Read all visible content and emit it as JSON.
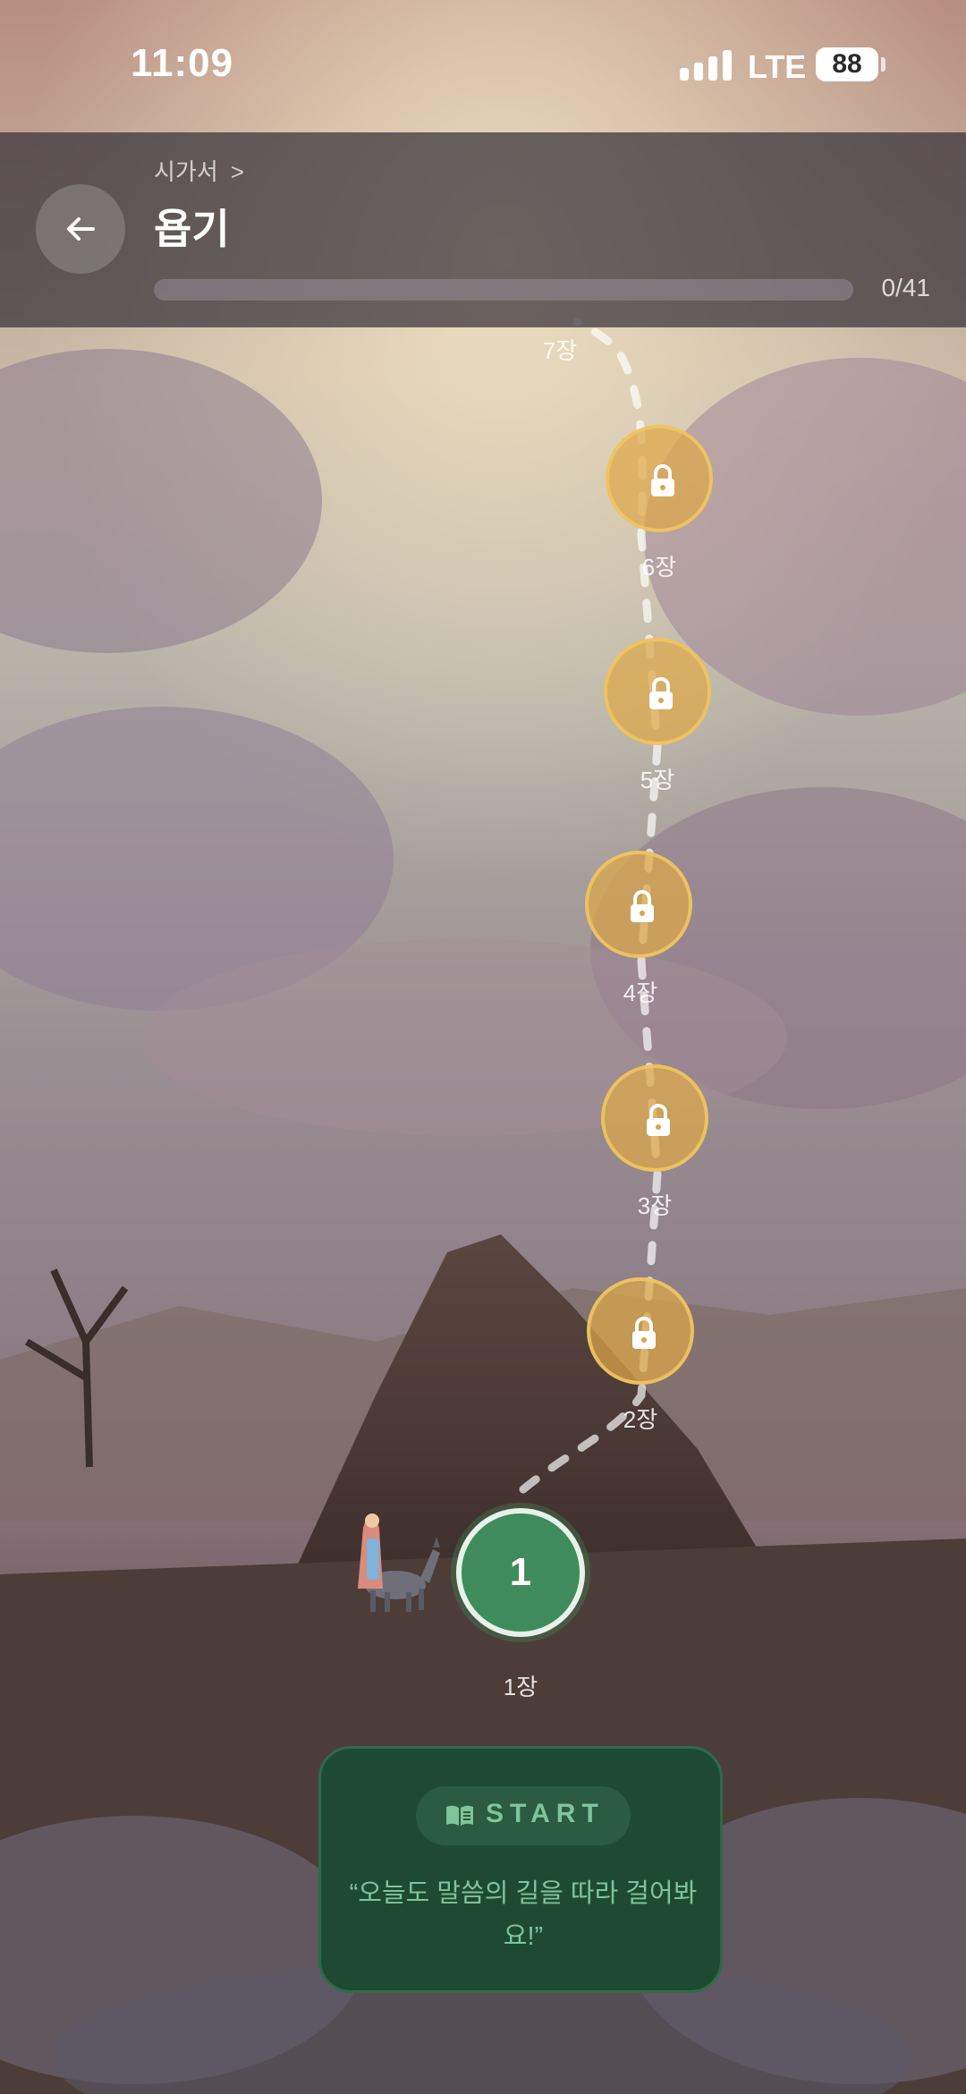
{
  "status_bar": {
    "time": "11:09",
    "network": "LTE",
    "battery": "88"
  },
  "header": {
    "breadcrumb": "시가서",
    "breadcrumb_separator": ">",
    "title": "욥기",
    "progress": {
      "current": 0,
      "total": 41,
      "label": "0/41"
    }
  },
  "path": {
    "current_chapter": "1",
    "chapters": [
      {
        "label": "1장",
        "locked": false
      },
      {
        "label": "2장",
        "locked": true
      },
      {
        "label": "3장",
        "locked": true
      },
      {
        "label": "4장",
        "locked": true
      },
      {
        "label": "5장",
        "locked": true
      },
      {
        "label": "6장",
        "locked": true
      },
      {
        "label": "7장",
        "locked": true
      }
    ]
  },
  "start_card": {
    "label": "START",
    "quote": "“오늘도 말씀의 길을 따라 걸어봐요!”"
  },
  "colors": {
    "accent_green": "#3f8b5c",
    "locked_gold": "#dea848",
    "card_green": "#1f4a32",
    "text_green": "#7fc49a"
  },
  "icons": {
    "back": "arrow-left-icon",
    "lock": "lock-icon",
    "book": "book-icon",
    "signal": "signal-icon",
    "battery": "battery-icon"
  }
}
